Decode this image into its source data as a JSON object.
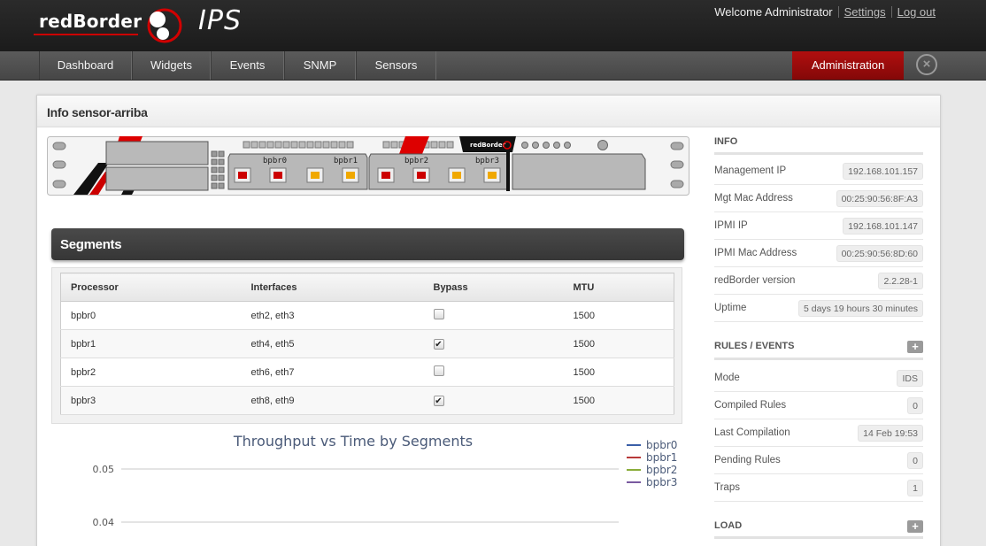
{
  "header": {
    "brand": "redBorder",
    "product": "IPS",
    "welcome": "Welcome Administrator",
    "settings_link": "Settings",
    "logout_link": "Log out"
  },
  "nav": {
    "items": [
      "Dashboard",
      "Widgets",
      "Events",
      "SNMP",
      "Sensors"
    ],
    "admin": "Administration",
    "close_icon": "close-icon"
  },
  "page": {
    "title": "Info sensor-arriba"
  },
  "device": {
    "brand": "redBorder",
    "ports": [
      "bpbr0",
      "bpbr1",
      "bpbr2",
      "bpbr3"
    ]
  },
  "segments": {
    "title": "Segments",
    "columns": [
      "Processor",
      "Interfaces",
      "Bypass",
      "MTU"
    ],
    "rows": [
      {
        "processor": "bpbr0",
        "interfaces": "eth2, eth3",
        "bypass": false,
        "mtu": "1500"
      },
      {
        "processor": "bpbr1",
        "interfaces": "eth4, eth5",
        "bypass": true,
        "mtu": "1500"
      },
      {
        "processor": "bpbr2",
        "interfaces": "eth6, eth7",
        "bypass": false,
        "mtu": "1500"
      },
      {
        "processor": "bpbr3",
        "interfaces": "eth8, eth9",
        "bypass": true,
        "mtu": "1500"
      }
    ]
  },
  "chart_data": {
    "type": "line",
    "title": "Throughput vs Time by Segments",
    "y_ticks": [
      "0.05",
      "0.04"
    ],
    "grid": true,
    "legend": "top-right",
    "series": [
      {
        "name": "bpbr0",
        "color": "#3a5fa8"
      },
      {
        "name": "bpbr1",
        "color": "#b83a3a"
      },
      {
        "name": "bpbr2",
        "color": "#8aad3a"
      },
      {
        "name": "bpbr3",
        "color": "#7a5aa0"
      }
    ]
  },
  "info": {
    "title": "INFO",
    "rows": [
      {
        "label": "Management IP",
        "value": "192.168.101.157"
      },
      {
        "label": "Mgt Mac Address",
        "value": "00:25:90:56:8F:A3"
      },
      {
        "label": "IPMI IP",
        "value": "192.168.101.147"
      },
      {
        "label": "IPMI Mac Address",
        "value": "00:25:90:56:8D:60"
      },
      {
        "label": "redBorder version",
        "value": "2.2.28-1"
      },
      {
        "label": "Uptime",
        "value": "5 days 19 hours 30 minutes"
      }
    ]
  },
  "rules": {
    "title": "RULES / EVENTS",
    "rows": [
      {
        "label": "Mode",
        "value": "IDS"
      },
      {
        "label": "Compiled Rules",
        "value": "0"
      },
      {
        "label": "Last Compilation",
        "value": "14 Feb 19:53"
      },
      {
        "label": "Pending Rules",
        "value": "0"
      },
      {
        "label": "Traps",
        "value": "1"
      }
    ]
  },
  "load": {
    "title": "LOAD"
  },
  "colors": {
    "accent": "#a00d0d",
    "header_bg": "#222222",
    "nav_bg": "#505050"
  }
}
